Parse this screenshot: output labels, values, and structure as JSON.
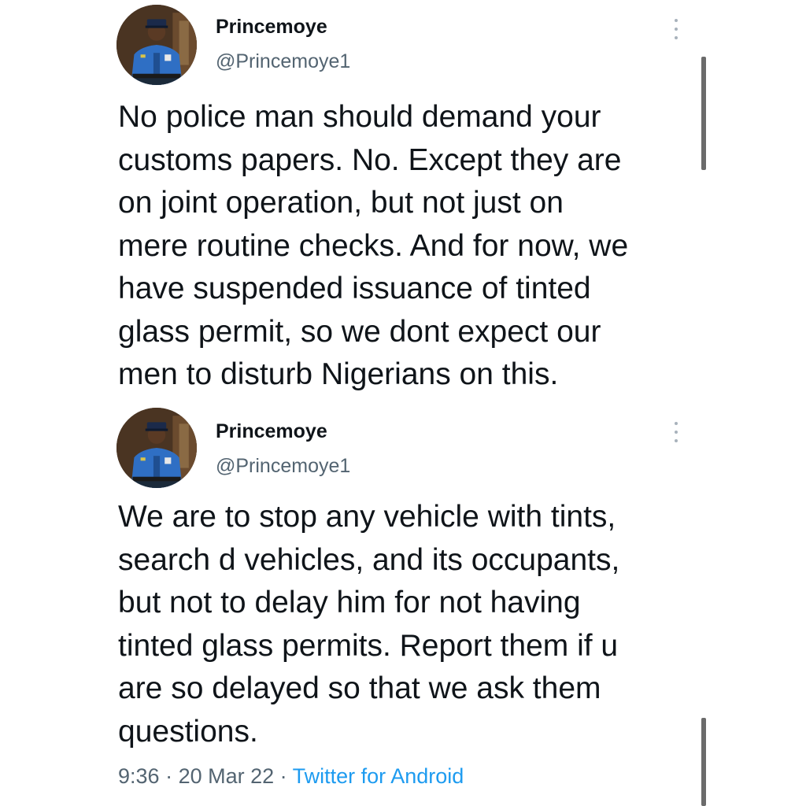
{
  "tweets": [
    {
      "display_name": "Princemoye",
      "handle": "@Princemoye1",
      "avatar_icon": "profile-photo-police-officer",
      "text": "No police man should demand your\ncustoms papers. No. Except they are\non joint operation, but not just on\nmere routine checks. And for now, we\nhave suspended issuance of tinted\nglass permit, so we dont expect our\nmen to disturb Nigerians on this."
    },
    {
      "display_name": "Princemoye",
      "handle": "@Princemoye1",
      "avatar_icon": "profile-photo-police-officer",
      "text": "We are to stop any vehicle with tints,\nsearch d vehicles, and its occupants,\nbut not to delay him for not having\ntinted glass permits. Report them if u\nare so delayed so that we ask them\nquestions."
    }
  ],
  "meta": {
    "time": "9:36",
    "separator": " · ",
    "date": "20 Mar 22",
    "source": "Twitter for Android"
  },
  "icons": {
    "more": "more-vertical-icon"
  },
  "colors": {
    "text": "#0f1419",
    "secondary": "#536471",
    "link": "#1d9bf0"
  }
}
